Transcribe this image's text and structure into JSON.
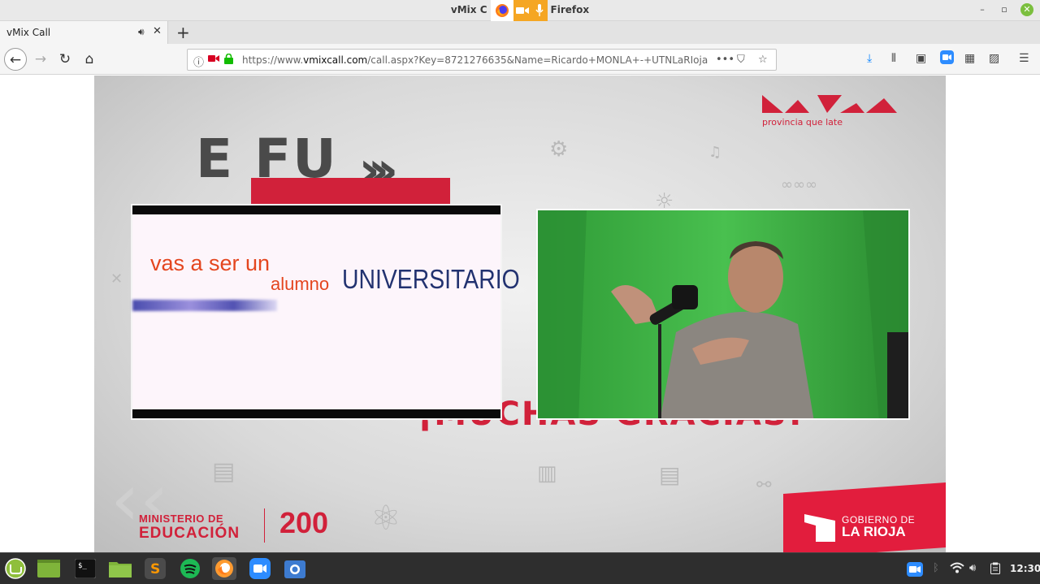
{
  "window": {
    "title_left": "vMix C",
    "title_right": "Firefox",
    "minimize": "–",
    "maximize": "▫",
    "close": "✕"
  },
  "tab": {
    "label": "vMix Call",
    "audio_icon": "speaker-icon",
    "close": "✕",
    "new_tab": "+"
  },
  "nav": {
    "url_prefix": "https://www.",
    "url_domain": "vmixcall.com",
    "url_rest": "/call.aspx?Key=8721276635&Name=Ricardo+MONLA+-+UTNLaRIoja",
    "more_actions": "•••"
  },
  "stage": {
    "riojatop_tagline": "provincia que late",
    "bg_title": "E FU",
    "bg_chevrons": "›››",
    "bg_bottom_text": "¡MUCHAS GRACIAS!",
    "left_video": {
      "line1": "vas a ser un",
      "line2": "alumno",
      "line3": "UNIVERSITARIO"
    },
    "ministerio_line1": "MINISTERIO DE",
    "ministerio_line2": "EDUCACIÓN",
    "logo_200": "200",
    "gobierno_line1": "GOBIERNO DE",
    "gobierno_line2": "LA RIOJA"
  },
  "taskbar": {
    "clock": "12:30"
  },
  "colors": {
    "brand_red": "#d1213a",
    "chroma_green": "#3cb444",
    "firefox_indicator": "#f5a623"
  }
}
